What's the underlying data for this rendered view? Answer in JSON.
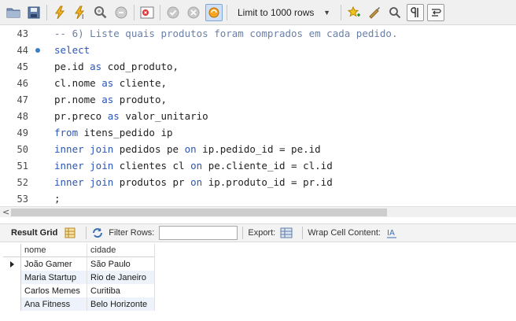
{
  "toolbar": {
    "limit_select": {
      "selected": "Limit to 1000 rows"
    },
    "icons": [
      "open-folder-icon",
      "save-icon",
      "execute-icon",
      "execute-current-icon",
      "explain-icon",
      "stop-icon",
      "toggle-error-icon",
      "commit-icon",
      "rollback-icon",
      "autocommit-icon",
      "add-snippet-icon",
      "beautify-icon",
      "find-icon",
      "invisible-chars-icon",
      "wrap-icon"
    ]
  },
  "editor": {
    "lines": [
      {
        "num": "43",
        "tokens": [
          {
            "t": "-- 6) Liste quais produtos foram comprados em cada pedido.",
            "k": "comment"
          }
        ]
      },
      {
        "num": "44",
        "marker": true,
        "tokens": [
          {
            "t": "select",
            "k": "kw"
          }
        ]
      },
      {
        "num": "45",
        "tokens": [
          {
            "t": "pe.id ",
            "k": "ident"
          },
          {
            "t": "as",
            "k": "kw"
          },
          {
            "t": " cod_produto,",
            "k": "ident"
          }
        ]
      },
      {
        "num": "46",
        "tokens": [
          {
            "t": "cl.nome ",
            "k": "ident"
          },
          {
            "t": "as",
            "k": "kw"
          },
          {
            "t": " cliente,",
            "k": "ident"
          }
        ]
      },
      {
        "num": "47",
        "tokens": [
          {
            "t": "pr.nome ",
            "k": "ident"
          },
          {
            "t": "as",
            "k": "kw"
          },
          {
            "t": " produto,",
            "k": "ident"
          }
        ]
      },
      {
        "num": "48",
        "tokens": [
          {
            "t": "pr.preco ",
            "k": "ident"
          },
          {
            "t": "as",
            "k": "kw"
          },
          {
            "t": " valor_unitario",
            "k": "ident"
          }
        ]
      },
      {
        "num": "49",
        "tokens": [
          {
            "t": "from",
            "k": "kw"
          },
          {
            "t": " itens_pedido ip",
            "k": "ident"
          }
        ]
      },
      {
        "num": "50",
        "tokens": [
          {
            "t": "inner join",
            "k": "kw"
          },
          {
            "t": " pedidos pe ",
            "k": "ident"
          },
          {
            "t": "on",
            "k": "kw"
          },
          {
            "t": " ip.pedido_id = pe.id",
            "k": "ident"
          }
        ]
      },
      {
        "num": "51",
        "tokens": [
          {
            "t": "inner join",
            "k": "kw"
          },
          {
            "t": " clientes cl ",
            "k": "ident"
          },
          {
            "t": "on",
            "k": "kw"
          },
          {
            "t": " pe.cliente_id = cl.id",
            "k": "ident"
          }
        ]
      },
      {
        "num": "52",
        "tokens": [
          {
            "t": "inner join",
            "k": "kw"
          },
          {
            "t": " produtos pr ",
            "k": "ident"
          },
          {
            "t": "on",
            "k": "kw"
          },
          {
            "t": " ip.produto_id = pr.id",
            "k": "ident"
          }
        ]
      },
      {
        "num": "53",
        "tokens": [
          {
            "t": ";",
            "k": "ident"
          }
        ]
      }
    ]
  },
  "result_bar": {
    "result_grid_label": "Result Grid",
    "filter_rows_label": "Filter Rows:",
    "filter_rows_value": "",
    "export_label": "Export:",
    "wrap_label": "Wrap Cell Content:"
  },
  "grid": {
    "columns": [
      "nome",
      "cidade"
    ],
    "rows": [
      [
        "João Gamer",
        "São Paulo"
      ],
      [
        "Maria Startup",
        "Rio de Janeiro"
      ],
      [
        "Carlos Memes",
        "Curitiba"
      ],
      [
        "Ana Fitness",
        "Belo Horizonte"
      ]
    ],
    "current_row": 0
  },
  "colors": {
    "keyword": "#2a56b8",
    "comment": "#6a7fa8",
    "alt_row": "#eef3fb"
  }
}
